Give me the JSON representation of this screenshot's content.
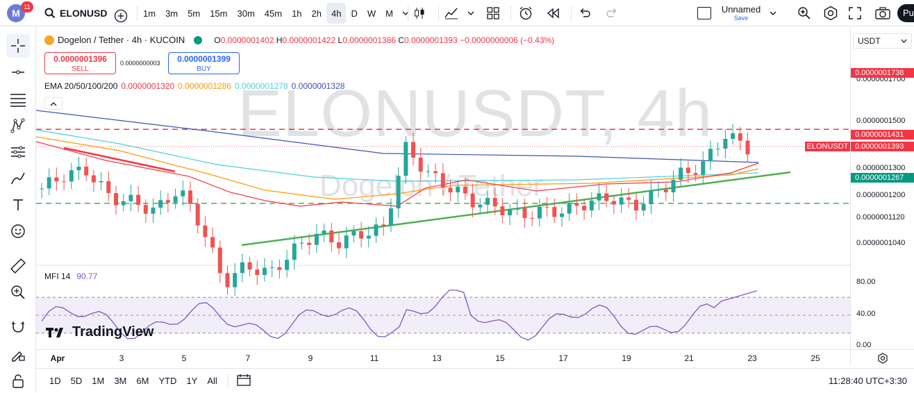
{
  "topbar": {
    "avatar_letter": "M",
    "notif_count": "11",
    "symbol": "ELONUSD",
    "intervals": [
      "1m",
      "3m",
      "5m",
      "15m",
      "30m",
      "45m",
      "1h",
      "2h",
      "4h",
      "D",
      "W",
      "M"
    ],
    "active_interval": "4h",
    "layout_name": "Unnamed",
    "layout_status": "Save",
    "publish_label": "Pu"
  },
  "legend": {
    "title": "Dogelon / Tether · 4h · KUCOIN",
    "o_label": "O",
    "o_value": "0.0000001402",
    "h_label": "H",
    "h_value": "0.0000001422",
    "l_label": "L",
    "l_value": "0.0000001386",
    "c_label": "C",
    "c_value": "0.0000001393",
    "change": "−0.0000000006 (−0.43%)",
    "sell_price": "0.0000001396",
    "sell_label": "SELL",
    "spread": "0.0000000003",
    "buy_price": "0.0000001399",
    "buy_label": "BUY",
    "ema_label": "EMA 20/50/100/200",
    "ema20": "0.0000001320",
    "ema50": "0.0000001286",
    "ema100": "0.0000001278",
    "ema200": "0.0000001328",
    "mfi_label": "MFI 14",
    "mfi_value": "90.77"
  },
  "watermark": {
    "symbol_tf": "ELONUSDT, 4h",
    "name": "Dogelon / Tether"
  },
  "branding": {
    "logo_text": "TradingView"
  },
  "price_axis": {
    "currency": "USDT",
    "labels": [
      "0.0000001700",
      "0.0000001500",
      "0.0000001300",
      "0.0000001200",
      "0.0000001120",
      "0.0000001040"
    ],
    "tag_top": "0.0000001738",
    "tag_mid": "0.0000001431",
    "tag_symbol": "ELONUSDT",
    "tag_last": "0.0000001393",
    "tag_green": "0.0000001267",
    "mfi_labels": [
      "80.00",
      "40.00",
      "0.00"
    ]
  },
  "time_axis": {
    "labels": [
      "Apr",
      "3",
      "5",
      "7",
      "9",
      "11",
      "13",
      "15",
      "17",
      "19",
      "21",
      "23",
      "25"
    ]
  },
  "bottombar": {
    "ranges": [
      "1D",
      "5D",
      "1M",
      "3M",
      "6M",
      "YTD",
      "1Y",
      "All"
    ],
    "clock": "11:28:40 UTC+3:30"
  },
  "colors": {
    "up": "#26a69a",
    "down": "#ef5350",
    "ema20": "#f23645",
    "ema50": "#ff9800",
    "ema100": "#4dd0e1",
    "ema200": "#3f51b5",
    "trend": "#4caf50",
    "mfi": "#7e57c2"
  },
  "chart_data": {
    "type": "candlestick",
    "title": "Dogelon / Tether · 4h · KUCOIN",
    "x_dates": [
      "Apr 1",
      "Apr 3",
      "Apr 5",
      "Apr 7",
      "Apr 9",
      "Apr 11",
      "Apr 13",
      "Apr 15",
      "Apr 17",
      "Apr 19",
      "Apr 21",
      "Apr 23"
    ],
    "close_series": [
      1.3,
      1.33,
      1.34,
      1.28,
      1.27,
      1.25,
      1.3,
      1.22,
      1.09,
      1.13,
      1.11,
      1.16,
      1.2,
      1.18,
      1.2,
      1.21,
      1.39,
      1.33,
      1.3,
      1.27,
      1.26,
      1.24,
      1.25,
      1.25,
      1.27,
      1.28,
      1.26,
      1.29,
      1.33,
      1.35,
      1.42,
      1.39
    ],
    "y_unit": "x 1e-7 USDT",
    "ylim": [
      1.0,
      1.75
    ],
    "horizontal_lines": [
      1.738,
      1.431,
      1.267
    ],
    "ema": {
      "ema20": 1.32,
      "ema50": 1.286,
      "ema100": 1.278,
      "ema200": 1.328
    },
    "mfi_range": [
      0,
      100
    ],
    "mfi_levels": [
      80,
      50,
      20
    ],
    "mfi_last": 90.77
  }
}
